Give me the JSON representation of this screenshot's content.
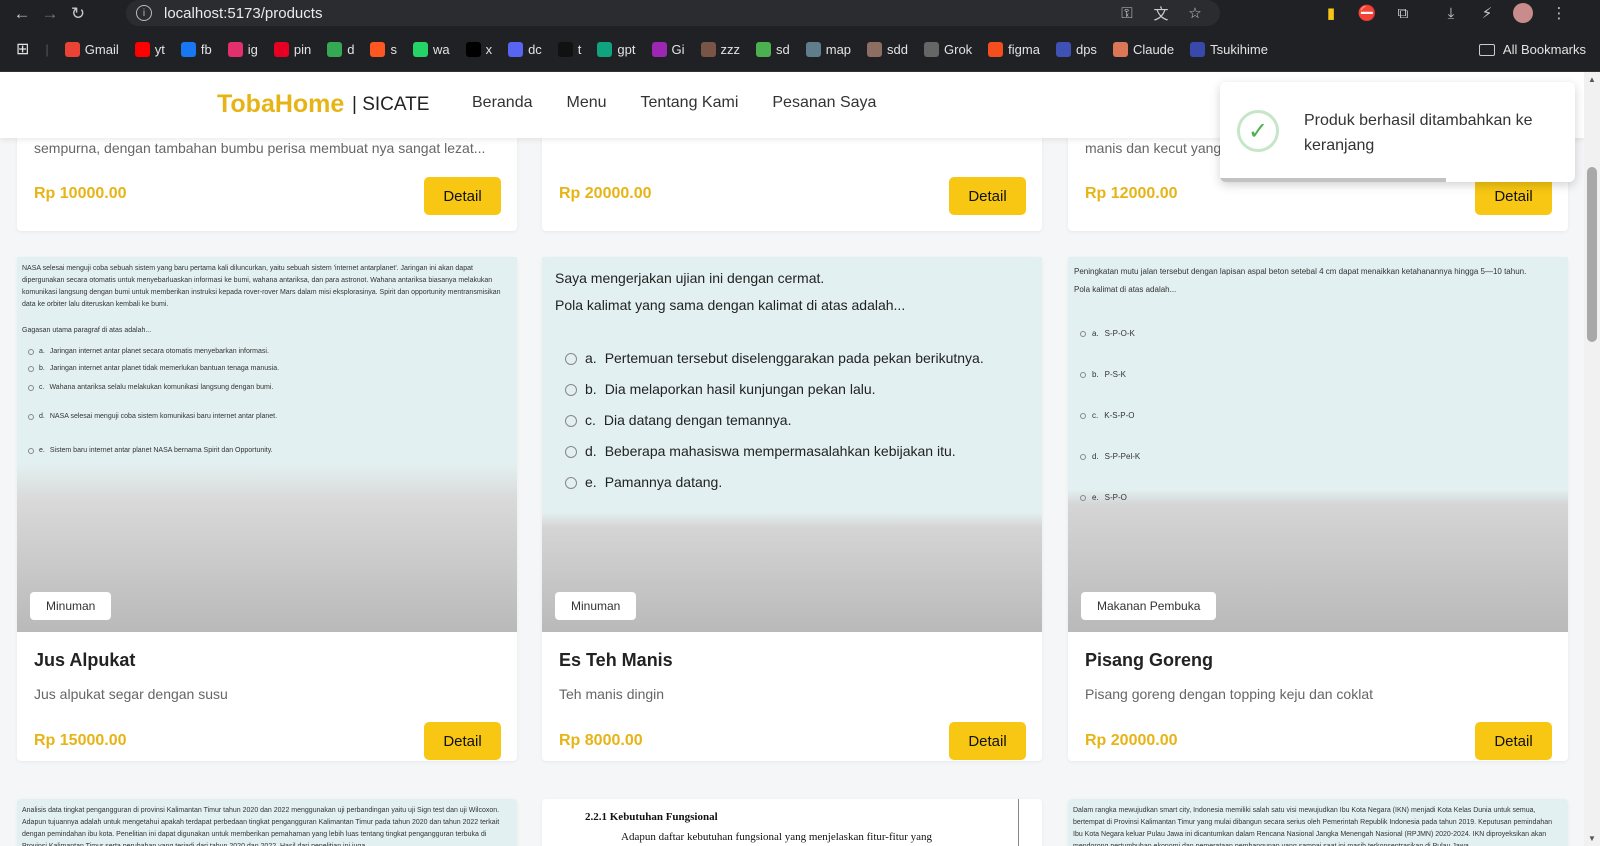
{
  "browser": {
    "url": "localhost:5173/products",
    "bookmarks": [
      "Gmail",
      "yt",
      "fb",
      "ig",
      "pin",
      "d",
      "s",
      "wa",
      "x",
      "dc",
      "t",
      "gpt",
      "Gi",
      "zzz",
      "sd",
      "map",
      "sdd",
      "Grok",
      "figma",
      "dps",
      "Claude",
      "Tsukihime"
    ],
    "all_bookmarks": "All Bookmarks"
  },
  "site": {
    "logo": "TobaHome",
    "logo_sub": "| SICATE",
    "menu": [
      "Beranda",
      "Menu",
      "Tentang Kami",
      "Pesanan Saya"
    ]
  },
  "toast": {
    "message": "Produk berhasil ditambahkan ke keranjang"
  },
  "top_row": [
    {
      "desc": "sempurna, dengan tambahan bumbu perisa membuat nya sangat lezat...",
      "price": "Rp 10000.00",
      "button": "Detail"
    },
    {
      "desc": "",
      "price": "Rp 20000.00",
      "button": "Detail"
    },
    {
      "desc": "manis dan kecut yang",
      "price": "Rp 12000.00",
      "button": "Detail"
    }
  ],
  "products": [
    {
      "badge": "Minuman",
      "name": "Jus Alpukat",
      "desc": "Jus alpukat segar dengan susu",
      "price": "Rp 15000.00",
      "button": "Detail"
    },
    {
      "badge": "Minuman",
      "name": "Es Teh Manis",
      "desc": "Teh manis dingin",
      "price": "Rp 8000.00",
      "button": "Detail"
    },
    {
      "badge": "Makanan Pembuka",
      "name": "Pisang Goreng",
      "desc": "Pisang goreng dengan topping keju dan coklat",
      "price": "Rp 20000.00",
      "button": "Detail"
    }
  ],
  "img1": {
    "para": "NASA selesai menguji coba sebuah sistem yang baru pertama kali diluncurkan, yaitu sebuah sistem 'internet antarplanet'. Jaringan ini akan dapat dipergunakan secara otomatis untuk menyebarluaskan informasi ke bumi, wahana antariksa, dan para astronot. Wahana antariksa biasanya melakukan komunikasi langsung dengan bumi untuk memberikan instruksi kepada rover-rover Mars dalam misi eksplorasinya. Spirit dan opportunity mentransmisikan data ke orbiter lalu diteruskan kembali ke bumi.",
    "question": "Gagasan utama paragraf di atas adalah...",
    "options": [
      {
        "k": "a.",
        "t": "Jaringan internet antar planet secara otomatis menyebarkan informasi."
      },
      {
        "k": "b.",
        "t": "Jaringan internet antar planet tidak memerlukan bantuan tenaga manusia."
      },
      {
        "k": "c.",
        "t": "Wahana antariksa selalu melakukan komunikasi langsung dengan bumi."
      },
      {
        "k": "d.",
        "t": "NASA selesai menguji coba sistem komunikasi baru internet antar planet."
      },
      {
        "k": "e.",
        "t": "Sistem baru internet antar planet NASA bernama Spirit dan Opportunity."
      }
    ]
  },
  "img2": {
    "sentence": "Saya mengerjakan ujian ini dengan cermat.",
    "question": "Pola kalimat yang sama dengan kalimat di atas adalah...",
    "options": [
      {
        "k": "a.",
        "t": "Pertemuan tersebut diselenggarakan pada pekan berikutnya."
      },
      {
        "k": "b.",
        "t": "Dia melaporkan hasil kunjungan pekan lalu."
      },
      {
        "k": "c.",
        "t": "Dia datang dengan temannya."
      },
      {
        "k": "d.",
        "t": "Beberapa mahasiswa mempermasalahkan kebijakan itu."
      },
      {
        "k": "e.",
        "t": "Pamannya datang."
      }
    ]
  },
  "img3": {
    "para": "Peningkatan mutu jalan tersebut dengan lapisan aspal beton setebal 4 cm dapat menaikkan ketahanannya hingga 5—10 tahun.",
    "question": "Pola kalimat di atas adalah...",
    "options": [
      {
        "k": "a.",
        "t": "S-P-O-K"
      },
      {
        "k": "b.",
        "t": "P-S-K"
      },
      {
        "k": "c.",
        "t": "K-S-P-O"
      },
      {
        "k": "d.",
        "t": "S-P-Pel-K"
      },
      {
        "k": "e.",
        "t": "S-P-O"
      }
    ]
  },
  "bottom": {
    "left_text": "Analisis data tingkat pengangguran di provinsi Kalimantan Timur tahun 2020 dan 2022 menggunakan uji perbandingan yaitu uji Sign test dan uji Wilcoxon. Adapun tujuannya adalah untuk mengetahui apakah terdapat perbedaan tingkat pengangguran Kalimantan Timur pada tahun 2020 dan tahun 2022 terkait dengan pemindahan ibu kota. Penelitian ini dapat digunakan untuk memberikan pemahaman yang lebih luas tentang tingkat pengangguran terbuka di Provinsi Kalimantan Timur serta perubahan yang terjadi dari tahun 2020 dan 2022. Hasil dari penelitian ini juga",
    "mid_heading": "2.2.1   Kebutuhan Fungsional",
    "mid_text": "Adapun daftar kebutuhan fungsional yang menjelaskan fitur-fitur yang",
    "right_text": "Dalam rangka mewujudkan smart city, Indonesia memiliki salah satu visi mewujudkan Ibu Kota Negara (IKN) menjadi Kota Kelas Dunia untuk semua, bertempat di Provinsi Kalimantan Timur yang mulai dibangun secara serius oleh Pemerintah Republik Indonesia pada tahun 2019. Keputusan pemindahan Ibu Kota Negara keluar Pulau Jawa ini dicantumkan dalam Rencana Nasional Jangka Menengah Nasional (RPJMN) 2020-2024. IKN diproyeksikan akan mendorong pertumbuhan ekonomi dan pemerataan pembangunan yang sampai saat ini masih terkonsentrasikan di Pulau Jawa."
  }
}
